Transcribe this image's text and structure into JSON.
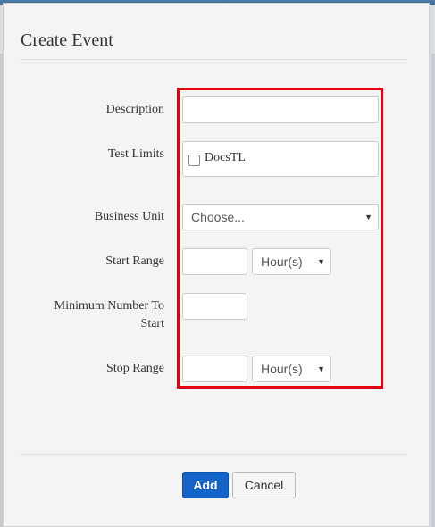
{
  "modal": {
    "title": "Create Event"
  },
  "form": {
    "description": {
      "label": "Description",
      "value": ""
    },
    "test_limits": {
      "label": "Test Limits",
      "option_label": "DocsTL",
      "checked": false
    },
    "business_unit": {
      "label": "Business Unit",
      "selected": "Choose..."
    },
    "start_range": {
      "label": "Start Range",
      "value": "",
      "unit": "Hour(s)"
    },
    "minimum_number": {
      "label_line1": "Minimum Number To",
      "label_line2": "Start",
      "value": ""
    },
    "stop_range": {
      "label": "Stop Range",
      "value": "",
      "unit": "Hour(s)"
    }
  },
  "buttons": {
    "add": "Add",
    "cancel": "Cancel"
  },
  "icons": {
    "select_caret": "chevron-down-icon",
    "checkbox": "checkbox-unchecked-icon"
  },
  "colors": {
    "primary": "#1464c7",
    "highlight": "#e2000f"
  }
}
